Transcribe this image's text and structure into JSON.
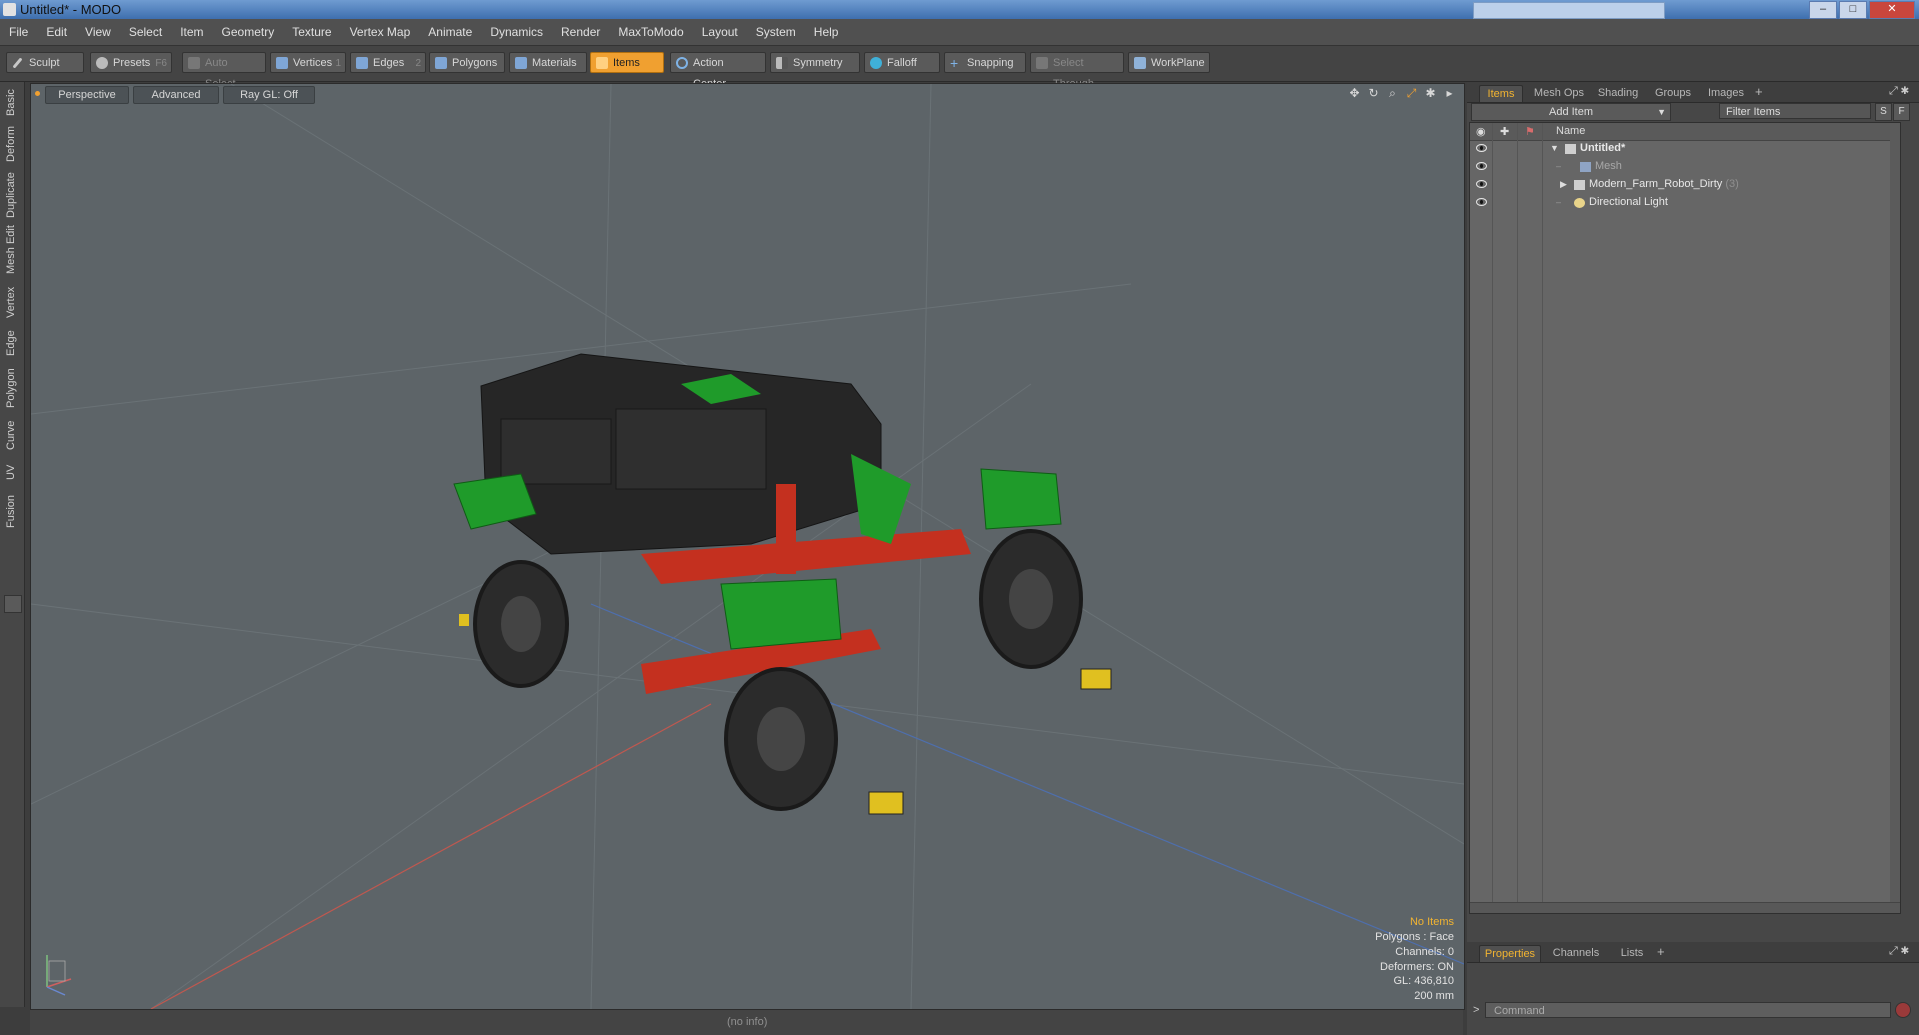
{
  "window": {
    "title": "Untitled* - MODO",
    "minimize": "–",
    "maximize": "□",
    "close": "✕"
  },
  "menu": [
    "File",
    "Edit",
    "View",
    "Select",
    "Item",
    "Geometry",
    "Texture",
    "Vertex Map",
    "Animate",
    "Dynamics",
    "Render",
    "MaxToModo",
    "Layout",
    "System",
    "Help"
  ],
  "toolbar": {
    "sculpt": "Sculpt",
    "presets": "Presets",
    "presets_hotkey": "F6",
    "auto_select": "Auto Select",
    "vertices": "Vertices",
    "vertices_hotkey": "1",
    "edges": "Edges",
    "edges_hotkey": "2",
    "polygons": "Polygons",
    "materials": "Materials",
    "items": "Items",
    "action_center": "Action Center",
    "symmetry": "Symmetry",
    "falloff": "Falloff",
    "snapping": "Snapping",
    "select_through": "Select Through",
    "workplane": "WorkPlane"
  },
  "left_tabs": [
    "Basic",
    "Deform",
    "Duplicate",
    "Mesh Edit",
    "Vertex",
    "Edge",
    "Polygon",
    "Curve",
    "UV",
    "Fusion"
  ],
  "viewport": {
    "view": "Perspective",
    "shading": "Advanced",
    "raygl": "Ray GL: Off",
    "stats": {
      "selection": "No Items",
      "polygons": "Polygons : Face",
      "channels": "Channels: 0",
      "deformers": "Deformers: ON",
      "gl": "GL: 436,810",
      "scale": "200 mm"
    }
  },
  "status": {
    "info": "(no info)"
  },
  "items_panel": {
    "tabs": [
      "Items",
      "Mesh Ops",
      "Shading",
      "Groups",
      "Images"
    ],
    "add_item": "Add Item",
    "filter_placeholder": "Filter Items",
    "s_button": "S",
    "f_button": "F",
    "name_header": "Name",
    "tree": [
      {
        "label": "Untitled*"
      },
      {
        "label": "Mesh"
      },
      {
        "label": "Modern_Farm_Robot_Dirty",
        "count": "(3)"
      },
      {
        "label": "Directional Light"
      }
    ]
  },
  "properties_panel": {
    "tabs": [
      "Properties",
      "Channels",
      "Lists"
    ],
    "command_placeholder": "Command",
    "command_prompt": ">"
  },
  "colors": {
    "accent": "#f0a030",
    "robot_green": "#1f9b2a",
    "robot_body": "#2a2a2a",
    "frame_red": "#c4301f"
  },
  "icons": {
    "falloff": "falloff-icon",
    "snapping": "snapping-icon",
    "visibility": "eye-icon"
  }
}
